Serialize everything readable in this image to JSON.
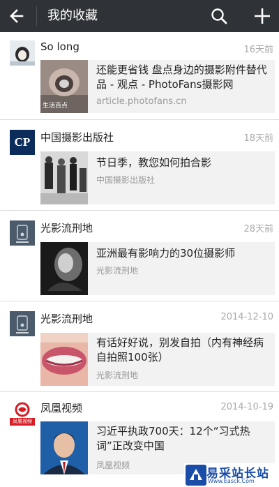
{
  "header": {
    "title": "我的收藏",
    "back_icon": "arrow-left-icon",
    "search_icon": "search-icon",
    "add_icon": "plus-icon",
    "bar_color": "#2f3337"
  },
  "favorites": [
    {
      "source": "So long",
      "time": "16天前",
      "title": "还能更省钱 盘点身边的摄影附件替代品 - 观点 - PhotoFans摄影网",
      "subtitle": "article.photofans.cn",
      "thumb_caption": "生活百点"
    },
    {
      "source": "中国摄影出版社",
      "time": "18天前",
      "avatar_text": "CP",
      "title": "节日季，教您如何拍合影",
      "subtitle": "中国摄影出版社"
    },
    {
      "source": "光影流刑地",
      "time": "28天前",
      "title": "亚洲最有影响力的30位摄影师",
      "subtitle": "光影流刑地"
    },
    {
      "source": "光影流刑地",
      "time": "2014-12-10",
      "title": "有话好好说，别发自拍（内有神经病自拍照100张）",
      "subtitle": "光影流刑地"
    },
    {
      "source": "凤凰视频",
      "time": "2014-10-19",
      "avatar_text": "凤凰视频",
      "title": "习近平执政700天：12个“习式热词”正改变中国",
      "subtitle": "凤凰视频"
    }
  ],
  "watermark": {
    "name": "易采站长站",
    "url": "Www.Easck.Com"
  }
}
